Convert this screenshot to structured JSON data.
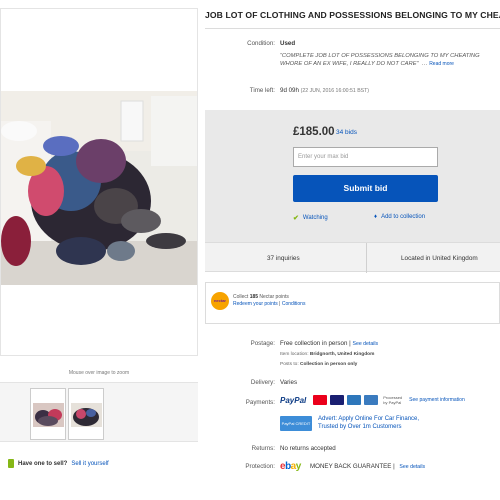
{
  "listing": {
    "title": "JOB LOT OF CLOTHING AND POSSESSIONS BELONGING TO MY CHEATING"
  },
  "gallery": {
    "mouse_hint": "Mouse over image to zoom"
  },
  "sell": {
    "question": "Have one to sell?",
    "link": "Sell it yourself"
  },
  "details": {
    "condition_label": "Condition:",
    "condition_value": "Used",
    "condition_quote": "“COMPLETE JOB LOT OF POSSESSIONS BELONGING TO MY CHEATING WHORE OF AN EX WIFE, I REALLY DO NOT CARE”",
    "read_more": "Read more",
    "time_left_label": "Time left:",
    "time_left_value": "9d 09h",
    "time_left_date": "(22 JUN, 2016  16:00:51 BST)"
  },
  "bidding": {
    "price": "£185.00",
    "bids": "34 bids",
    "input_placeholder": "Enter your max bid",
    "submit_label": "Submit bid",
    "watching_label": "Watching",
    "add_collection_label": "Add to collection"
  },
  "stats": {
    "inquiries": "37 inquiries",
    "location": "Located in United Kingdom"
  },
  "nectar": {
    "logo_text": "nectar",
    "line1_prefix": "Collect ",
    "points": "185",
    "line1_suffix": " Nectar points",
    "redeem_link": "Redeem your points",
    "separator": " | ",
    "conditions_link": "Conditions"
  },
  "postage": {
    "label": "Postage:",
    "value": "Free collection in person",
    "see_details": "See details",
    "item_location_label": "Item location:",
    "item_location_value": "Bridgnorth, United Kingdom",
    "posts_to_label": "Posts to:",
    "posts_to_value": "Collection in person only"
  },
  "delivery": {
    "label": "Delivery:",
    "value": "Varies"
  },
  "payments": {
    "label": "Payments:",
    "paypal": "PayPal",
    "processed_line1": "Processed",
    "processed_line2": "by PayPal",
    "see_payment_info": "See payment information",
    "credit_logo_text": "PayPal CREDIT",
    "credit_line1": "Advert: Apply Online For Car Finance,",
    "credit_line2": "Trusted by Over 1m Customers"
  },
  "returns": {
    "label": "Returns:",
    "value": "No returns accepted"
  },
  "protection": {
    "label": "Protection:",
    "logo_e": "e",
    "logo_b": "b",
    "logo_a": "a",
    "logo_y": "y",
    "value": "MONEY BACK GUARANTEE",
    "see_details": "See details"
  },
  "colors": {
    "ebay_blue": "#0654ba",
    "bid_panel": "#e9e9e9",
    "watch_check": "#85b716",
    "mastercard": "#eb001b",
    "visa": "#1a1f71",
    "amex": "#2e77bb"
  }
}
